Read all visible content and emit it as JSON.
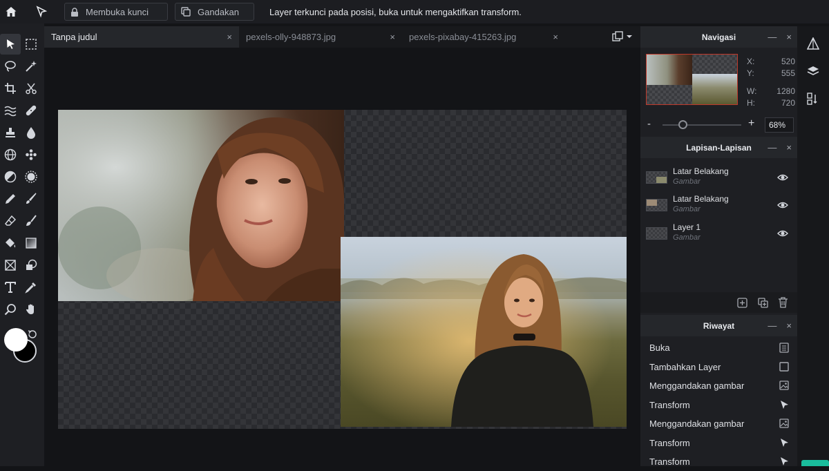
{
  "topbar": {
    "unlock_label": "Membuka kunci",
    "duplicate_label": "Gandakan",
    "message": "Layer terkunci pada posisi, buka untuk mengaktifkan transform."
  },
  "tabs": [
    {
      "label": "Tanpa judul",
      "close": "×"
    },
    {
      "label": "pexels-olly-948873.jpg",
      "close": "×"
    },
    {
      "label": "pexels-pixabay-415263.jpg",
      "close": "×"
    }
  ],
  "navigator": {
    "title": "Navigasi",
    "minimize": "—",
    "close": "×",
    "x_label": "X:",
    "x_value": "520",
    "y_label": "Y:",
    "y_value": "555",
    "w_label": "W:",
    "w_value": "1280",
    "h_label": "H:",
    "h_value": "720",
    "zoom_minus": "-",
    "zoom_plus": "+",
    "zoom_value": "68%"
  },
  "layers": {
    "title": "Lapisan-Lapisan",
    "minimize": "—",
    "close": "×",
    "items": [
      {
        "name": "Latar Belakang",
        "type": "Gambar"
      },
      {
        "name": "Latar Belakang",
        "type": "Gambar"
      },
      {
        "name": "Layer 1",
        "type": "Gambar"
      }
    ]
  },
  "history": {
    "title": "Riwayat",
    "minimize": "—",
    "close": "×",
    "items": [
      {
        "label": "Buka",
        "icon": "document-icon"
      },
      {
        "label": "Tambahkan Layer",
        "icon": "square-icon"
      },
      {
        "label": "Menggandakan gambar",
        "icon": "image-icon"
      },
      {
        "label": "Transform",
        "icon": "arrow-icon"
      },
      {
        "label": "Menggandakan gambar",
        "icon": "image-icon"
      },
      {
        "label": "Transform",
        "icon": "arrow-icon"
      },
      {
        "label": "Transform",
        "icon": "arrow-icon"
      }
    ]
  },
  "colors": {
    "foreground": "#ffffff",
    "background": "#000000",
    "accent": "#1abc9c",
    "thumb_border": "#c0392b"
  }
}
